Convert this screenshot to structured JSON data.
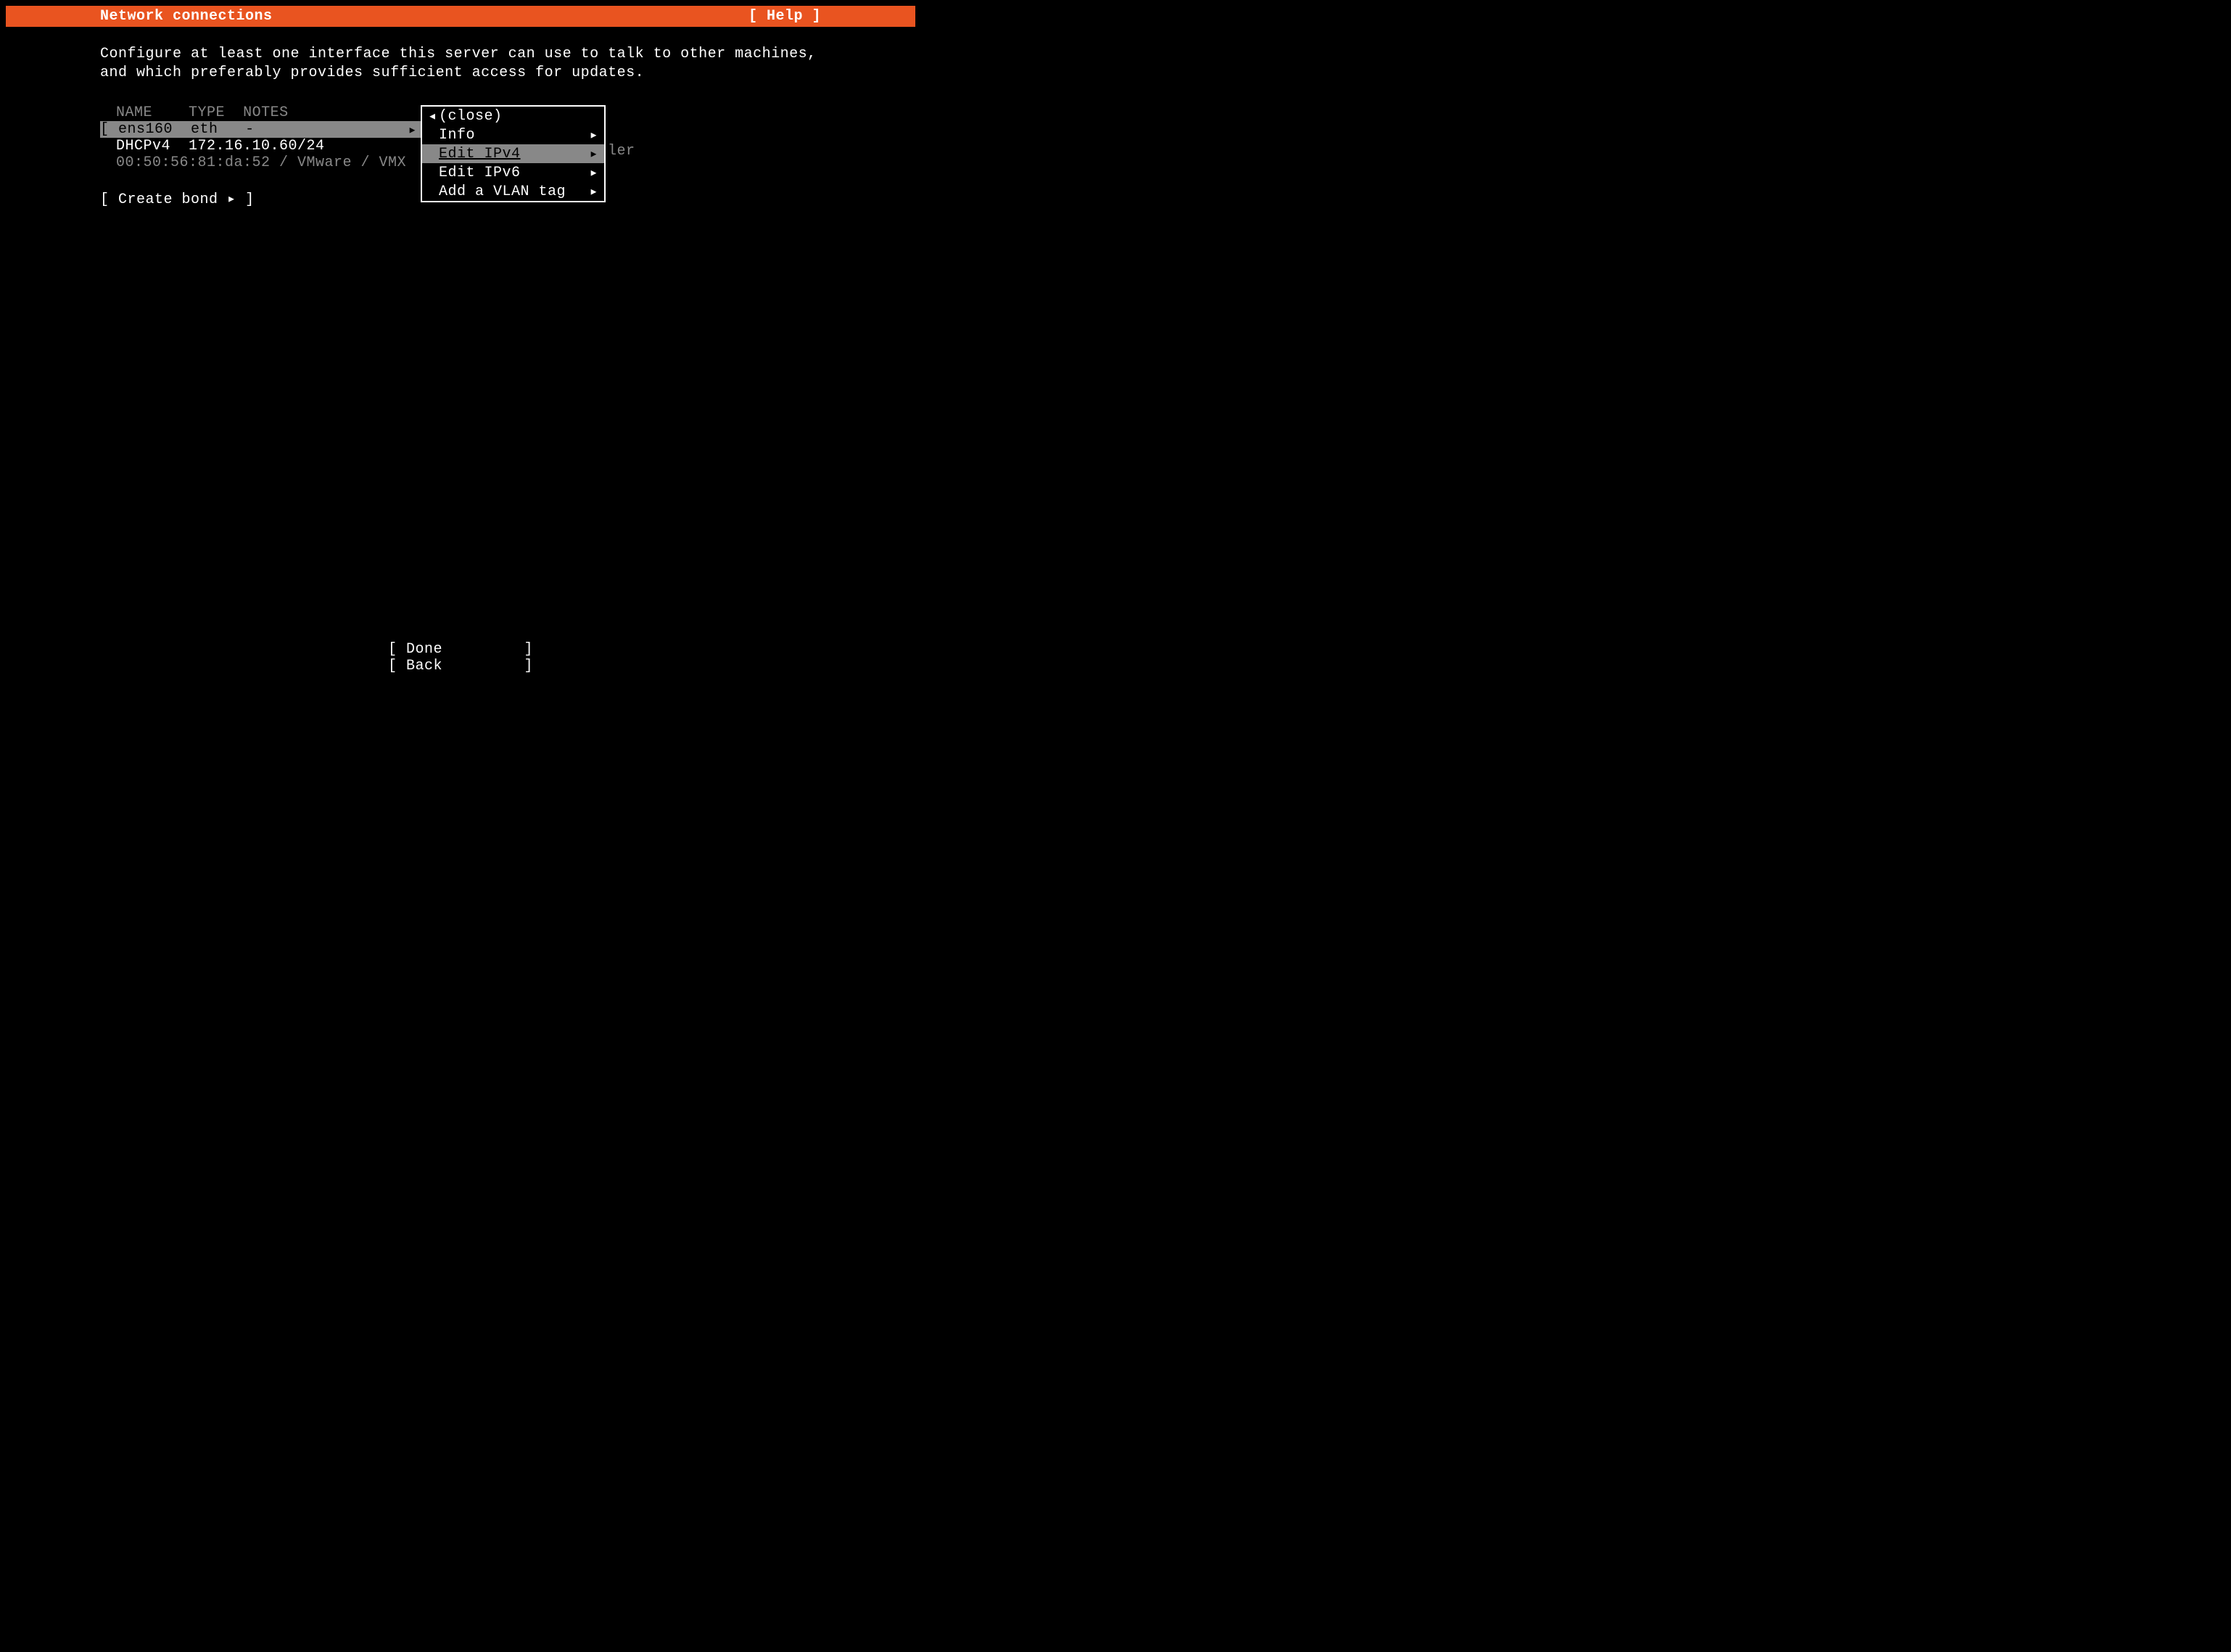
{
  "titlebar": {
    "title": "Network connections",
    "help": "[ Help ]"
  },
  "intro": {
    "text": "Configure at least one interface this server can use to talk to other machines, and which preferably provides sufficient access for updates."
  },
  "headers": {
    "name": "NAME",
    "type": "TYPE",
    "notes": "NOTES"
  },
  "interface": {
    "name": "ens160",
    "type": "eth",
    "notes": "-"
  },
  "dhcp": {
    "label": "DHCPv4",
    "address": "172.16.10.60/24"
  },
  "mac": {
    "info": "00:50:56:81:da:52 / VMware / VMX",
    "trailing": "ler"
  },
  "create_bond": "[ Create bond ▸ ]",
  "menu": {
    "items": [
      {
        "text": "(close)",
        "arrow_left": "◂",
        "arrow_right": ""
      },
      {
        "text": "Info",
        "arrow_left": "",
        "arrow_right": "▸"
      },
      {
        "text": "Edit IPv4",
        "arrow_left": "",
        "arrow_right": "▸"
      },
      {
        "text": "Edit IPv6",
        "arrow_left": "",
        "arrow_right": "▸"
      },
      {
        "text": "Add a VLAN tag",
        "arrow_left": "",
        "arrow_right": "▸"
      }
    ]
  },
  "footer": {
    "done": "[ Done         ]",
    "back": "[ Back         ]"
  }
}
